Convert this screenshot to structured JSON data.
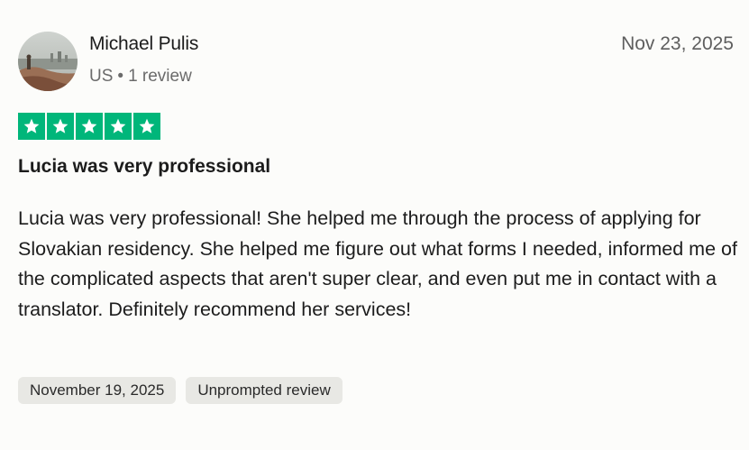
{
  "reviewer": {
    "name": "Michael Pulis",
    "country": "US",
    "separator": "•",
    "review_count": "1 review"
  },
  "review": {
    "date": "Nov 23, 2025",
    "rating": 5,
    "star_color": "#00b67a",
    "title": "Lucia was very professional",
    "body": "Lucia was very professional! She helped me through the process of applying for Slovakian residency. She helped me figure out what forms I needed, informed me of the complicated aspects that aren't super clear, and even put me in contact with a translator. Definitely recommend her services!"
  },
  "tags": {
    "experience_date": "November 19, 2025",
    "review_type": "Unprompted review"
  },
  "icons": {
    "star": "star-icon",
    "avatar": "avatar-photo"
  }
}
